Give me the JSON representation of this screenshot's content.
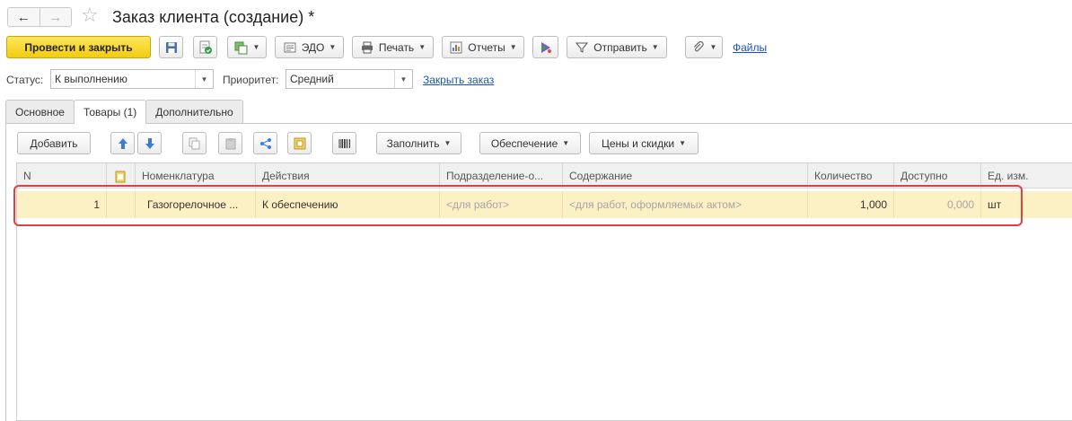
{
  "window": {
    "title": "Заказ клиента (создание) *",
    "nav_back": "←",
    "nav_forward": "→",
    "favorite_icon": "star-icon"
  },
  "toolbar": {
    "post_close": "Провести и закрыть",
    "edo": "ЭДО",
    "print": "Печать",
    "reports": "Отчеты",
    "send": "Отправить",
    "files": "Файлы"
  },
  "status": {
    "status_label": "Статус:",
    "status_value": "К выполнению",
    "priority_label": "Приоритет:",
    "priority_value": "Средний",
    "close_order": "Закрыть заказ"
  },
  "tabs": [
    {
      "label": "Основное"
    },
    {
      "label": "Товары (1)",
      "active": true
    },
    {
      "label": "Дополнительно"
    }
  ],
  "grid_toolbar": {
    "add": "Добавить",
    "fill": "Заполнить",
    "supply": "Обеспечение",
    "prices": "Цены и скидки"
  },
  "table": {
    "headers": [
      "N",
      "",
      "Номенклатура",
      "Действия",
      "Подразделение-о...",
      "Содержание",
      "Количество",
      "Доступно",
      "Ед. изм."
    ],
    "rows": [
      {
        "n": "1",
        "flag": "",
        "item": "Газогорелочное ...",
        "action": "К обеспечению",
        "division": "<для работ>",
        "content": "<для работ, оформляемых актом>",
        "qty": "1,000",
        "available": "0,000",
        "unit": "шт"
      }
    ]
  },
  "colors": {
    "primary_button": "#f3cc0c",
    "row_highlight": "#fbf1c5",
    "annotation_frame": "#e04040",
    "link": "#1a55b5"
  }
}
